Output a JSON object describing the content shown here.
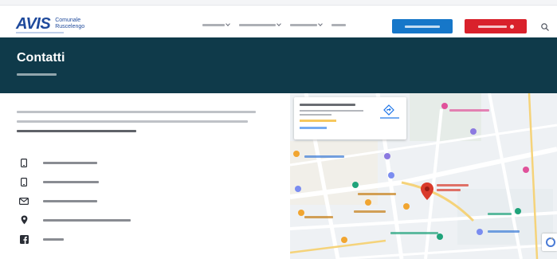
{
  "header": {
    "logo_word": "AVIS",
    "logo_subtitle": "Comunale Ruscelengo",
    "nav": [
      {
        "label": "",
        "has_caret": true
      },
      {
        "label": "",
        "has_caret": true
      },
      {
        "label": "",
        "has_caret": true
      },
      {
        "label": "",
        "has_caret": false
      }
    ],
    "cta_primary": "",
    "cta_secondary": ""
  },
  "hero": {
    "title": "Contatti",
    "breadcrumb": ""
  },
  "intro": {
    "text": "",
    "highlight": ""
  },
  "contacts": [
    {
      "icon": "mobile-phone-icon",
      "value": ""
    },
    {
      "icon": "mobile-phone-icon",
      "value": ""
    },
    {
      "icon": "mail-icon",
      "value": ""
    },
    {
      "icon": "location-pin-icon",
      "value": ""
    },
    {
      "icon": "facebook-icon",
      "value": ""
    }
  ],
  "map": {
    "place_name": "",
    "place_address": "",
    "rating": "",
    "reviews": "",
    "view_larger_map": "",
    "directions": ""
  },
  "colors": {
    "brand_blue": "#1f4a9c",
    "cta_blue": "#1677c9",
    "cta_red": "#d9212b",
    "hero_bg": "#0f3a4a"
  }
}
